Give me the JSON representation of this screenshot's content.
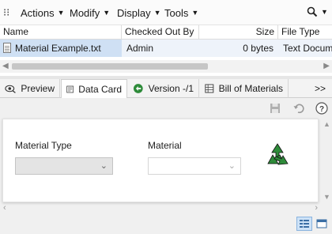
{
  "toolbar": {
    "menus": [
      {
        "label": "Actions",
        "icon": "chevron-down-icon"
      },
      {
        "label": "Modify",
        "icon": "chevron-down-icon"
      },
      {
        "label": "Display",
        "icon": "chevron-down-icon"
      },
      {
        "label": "Tools",
        "icon": "chevron-down-icon"
      }
    ],
    "search_icon": "magnifier-icon"
  },
  "grid": {
    "columns": [
      "Name",
      "Checked Out By",
      "Size",
      "File Type"
    ],
    "rows": [
      {
        "name": "Material Example.txt",
        "checked_out_by": "Admin",
        "size": "0 bytes",
        "file_type": "Text Document"
      }
    ]
  },
  "tabs": [
    {
      "label": "Preview",
      "icon": "preview-icon",
      "active": false
    },
    {
      "label": "Data Card",
      "icon": "data-card-icon",
      "active": true
    },
    {
      "label": "Version -/1",
      "icon": "version-icon",
      "active": false
    },
    {
      "label": "Bill of Materials",
      "icon": "bill-of-materials-icon",
      "active": false
    }
  ],
  "tabs_overflow_label": ">>",
  "data_card": {
    "fields": [
      {
        "label": "Material Type",
        "value": ""
      },
      {
        "label": "Material",
        "value": ""
      }
    ],
    "logo_icon": "recycle-logo-icon"
  },
  "colors": {
    "selected_row": "#cfe0f4",
    "active_tab": "#ffffff",
    "logo_green": "#2e8b3a"
  }
}
